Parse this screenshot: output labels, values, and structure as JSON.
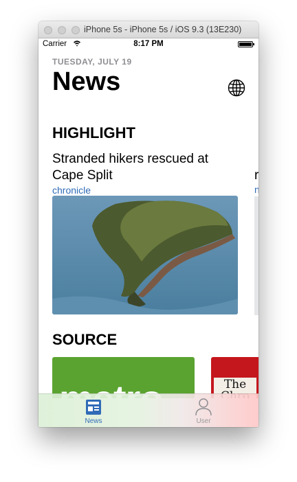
{
  "window": {
    "title": "iPhone 5s - iPhone 5s / iOS 9.3 (13E230)"
  },
  "status_bar": {
    "carrier": "Carrier",
    "time": "8:17 PM"
  },
  "header": {
    "date": "TUESDAY, JULY 19",
    "title": "News"
  },
  "highlight": {
    "section_title": "HIGHLIGHT",
    "articles": [
      {
        "title": "Stranded hikers rescued at Cape Split",
        "source": "chronicle"
      },
      {
        "title_fragment": "r",
        "source_fragment": "n"
      }
    ]
  },
  "sources": {
    "section_title": "SOURCE",
    "items": [
      {
        "logo_text": "metro",
        "color": "#5aa330"
      },
      {
        "logo_text": "The Chro",
        "color": "#c4171d"
      }
    ]
  },
  "tab_bar": {
    "tabs": [
      {
        "label": "News",
        "icon": "news-icon",
        "selected": true
      },
      {
        "label": "User",
        "icon": "user-icon",
        "selected": false
      }
    ]
  },
  "colors": {
    "accent": "#2f6bb7",
    "secondary_text": "#8e8e93"
  }
}
